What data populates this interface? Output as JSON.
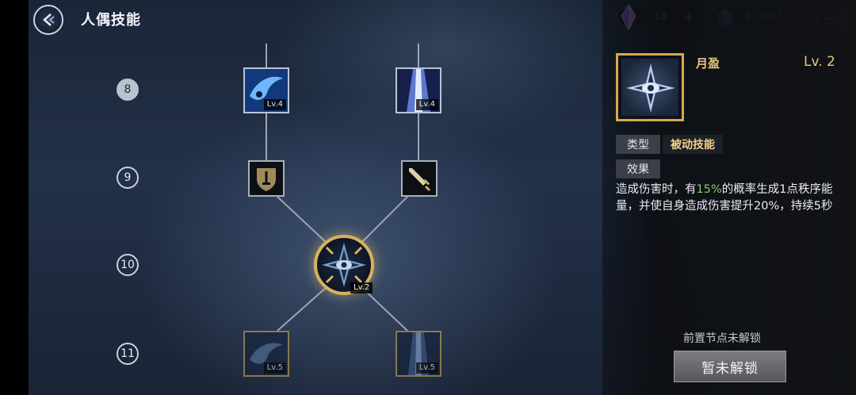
{
  "header": {
    "title": "人偶技能",
    "gem_count": "18",
    "plus_label": "+",
    "energy_count": "423025"
  },
  "rows": [
    "8",
    "9",
    "10",
    "11"
  ],
  "nodes": {
    "r8_left_lv": "Lv.4",
    "r8_right_lv": "Lv.4",
    "center_lv": "Lv.2",
    "r11_left_lv": "Lv.5",
    "r11_right_lv": "Lv.5"
  },
  "detail": {
    "name": "月盈",
    "level": "Lv. 2",
    "type_label": "类型",
    "type_value": "被动技能",
    "effect_label": "效果",
    "desc_part1": "造成伤害时，有",
    "desc_highlight": "15%",
    "desc_part2": "的概率生成1点秩序能量，并使自身造成伤害提升20%，持续5秒",
    "lock_note": "前置节点未解锁",
    "unlock_button": "暂未解锁"
  },
  "colors": {
    "accent_gold": "#d9b25e",
    "highlight_green": "#79d26a",
    "name_gold": "#e8c67a"
  }
}
